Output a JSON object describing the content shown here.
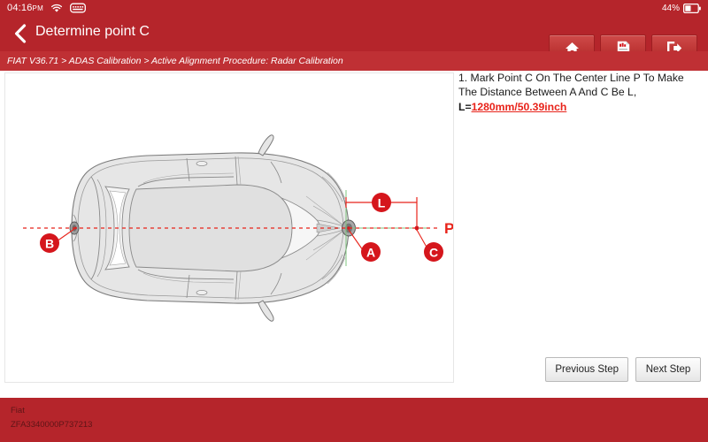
{
  "statusbar": {
    "time": "04:16",
    "ampm": "PM",
    "wifi_icon": "wifi-icon",
    "vpn_icon": "vpn-key-icon",
    "battery_percent": "44%",
    "battery_icon": "battery-icon"
  },
  "header": {
    "back_icon": "chevron-left-icon",
    "title": "Determine point C",
    "buttons": [
      {
        "name": "home-button",
        "icon": "home-icon"
      },
      {
        "name": "report-button",
        "icon": "document-report-icon"
      },
      {
        "name": "exit-button",
        "icon": "exit-arrow-icon"
      }
    ]
  },
  "breadcrumb": {
    "text": "FIAT V36.71 > ADAS Calibration > Active Alignment Procedure: Radar Calibration"
  },
  "instruction": {
    "line1": "1. Mark Point C On The Center Line P To Make The Distance Between A And C Be L,",
    "label": "L=",
    "value": "1280mm/50.39inch"
  },
  "buttons": {
    "previous": "Previous Step",
    "next": "Next Step"
  },
  "diagram": {
    "labels": {
      "a": "A",
      "b": "B",
      "c": "C",
      "l": "L",
      "p": "P"
    },
    "colors": {
      "marker_red": "#d5161c",
      "center_line": "#e8231a",
      "vertical_guide": "#7cc47c",
      "car_outline": "#7b7b7b",
      "car_fill": "#e3e3e3"
    }
  },
  "footer": {
    "make": "Fiat",
    "vin": "ZFA3340000P737213"
  },
  "theme": {
    "header_red": "#b5252b",
    "breadcrumb_red": "#bf3034",
    "accent_red": "#e8231a"
  }
}
